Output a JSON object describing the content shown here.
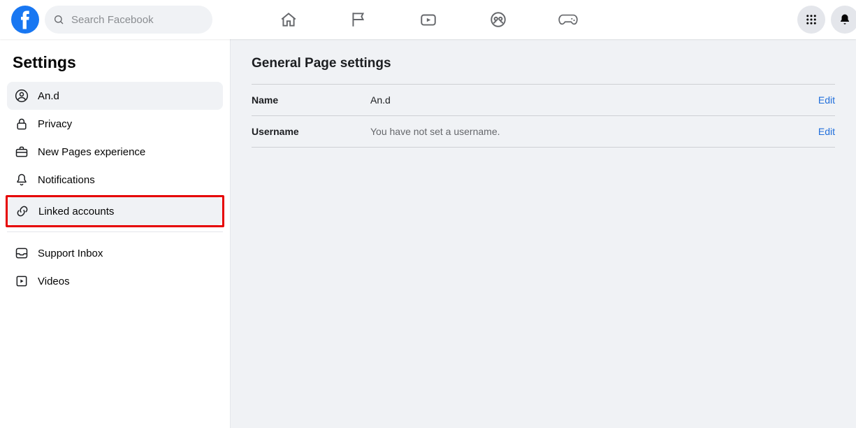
{
  "header": {
    "search_placeholder": "Search Facebook"
  },
  "sidebar": {
    "title": "Settings",
    "items": [
      {
        "label": "An.d",
        "selected": true,
        "highlighted": false
      },
      {
        "label": "Privacy",
        "selected": false,
        "highlighted": false
      },
      {
        "label": "New Pages experience",
        "selected": false,
        "highlighted": false
      },
      {
        "label": "Notifications",
        "selected": false,
        "highlighted": false
      },
      {
        "label": "Linked accounts",
        "selected": true,
        "highlighted": true
      },
      {
        "label": "Support Inbox",
        "selected": false,
        "highlighted": false
      },
      {
        "label": "Videos",
        "selected": false,
        "highlighted": false
      }
    ]
  },
  "content": {
    "title": "General Page settings",
    "rows": {
      "name": {
        "label": "Name",
        "value": "An.d",
        "action": "Edit"
      },
      "username": {
        "label": "Username",
        "value": "You have not set a username.",
        "action": "Edit"
      }
    }
  }
}
